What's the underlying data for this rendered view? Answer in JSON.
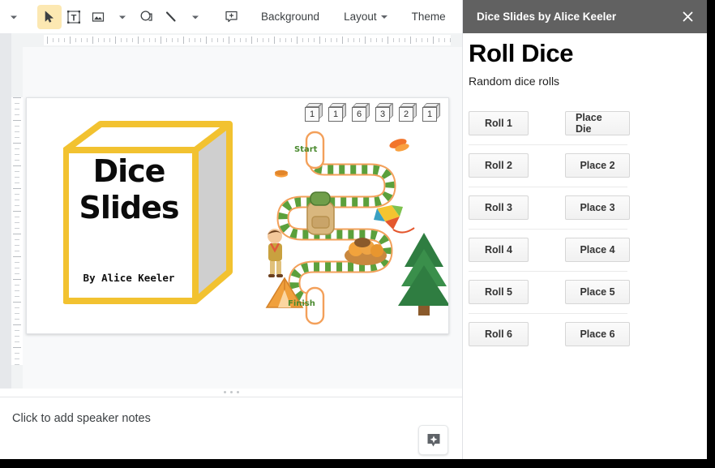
{
  "window": {
    "right_edge_color": "#000000"
  },
  "toolbar": {
    "items": [
      {
        "name": "undo-redo-caret",
        "icon": "caret-down-icon",
        "label": ""
      },
      {
        "name": "select-tool",
        "icon": "cursor-arrow-icon",
        "label": "",
        "active": true
      },
      {
        "name": "text-box-tool",
        "icon": "text-box-icon",
        "label": ""
      },
      {
        "name": "insert-image-tool",
        "icon": "image-icon",
        "label": ""
      },
      {
        "name": "insert-image-caret",
        "icon": "caret-down-icon",
        "label": ""
      },
      {
        "name": "shape-tool",
        "icon": "shape-icon",
        "label": ""
      },
      {
        "name": "line-tool",
        "icon": "line-icon",
        "label": ""
      },
      {
        "name": "line-caret",
        "icon": "caret-down-icon",
        "label": ""
      },
      {
        "name": "add-comment-tool",
        "icon": "comment-plus-icon",
        "label": ""
      }
    ],
    "background_label": "Background",
    "layout_label": "Layout",
    "theme_label": "Theme",
    "more_label": "⋯",
    "collapse_icon": "chevron-up-icon"
  },
  "slide": {
    "dice": [
      {
        "value": "1"
      },
      {
        "value": "1"
      },
      {
        "value": "6"
      },
      {
        "value": "3"
      },
      {
        "value": "2"
      },
      {
        "value": "1"
      }
    ],
    "cube": {
      "line1": "Dice",
      "line2": "Slides",
      "byline": "By Alice Keeler",
      "accent_color": "#f2c230",
      "side_color": "#cfcfcf"
    },
    "board": {
      "start_label": "Start",
      "finish_label": "Finish",
      "path_color": "#5ba03c",
      "track_color": "#f3a05a"
    }
  },
  "notes": {
    "placeholder": "Click to add speaker notes",
    "explore_icon": "explore-sparkle-icon"
  },
  "sidebar": {
    "header_title": "Dice Slides by Alice Keeler",
    "close_icon": "close-icon",
    "heading": "Roll Dice",
    "subheading": "Random dice rolls",
    "header_bg": "#616161",
    "rows": [
      {
        "roll_label": "Roll 1",
        "place_label": "Place Die",
        "divider": false
      },
      {
        "roll_label": "Roll 2",
        "place_label": "Place 2",
        "divider": true
      },
      {
        "roll_label": "Roll 3",
        "place_label": "Place 3",
        "divider": true
      },
      {
        "roll_label": "Roll 4",
        "place_label": "Place 4",
        "divider": true
      },
      {
        "roll_label": "Roll 5",
        "place_label": "Place 5",
        "divider": true
      },
      {
        "roll_label": "Roll 6",
        "place_label": "Place 6",
        "divider": true
      }
    ]
  }
}
